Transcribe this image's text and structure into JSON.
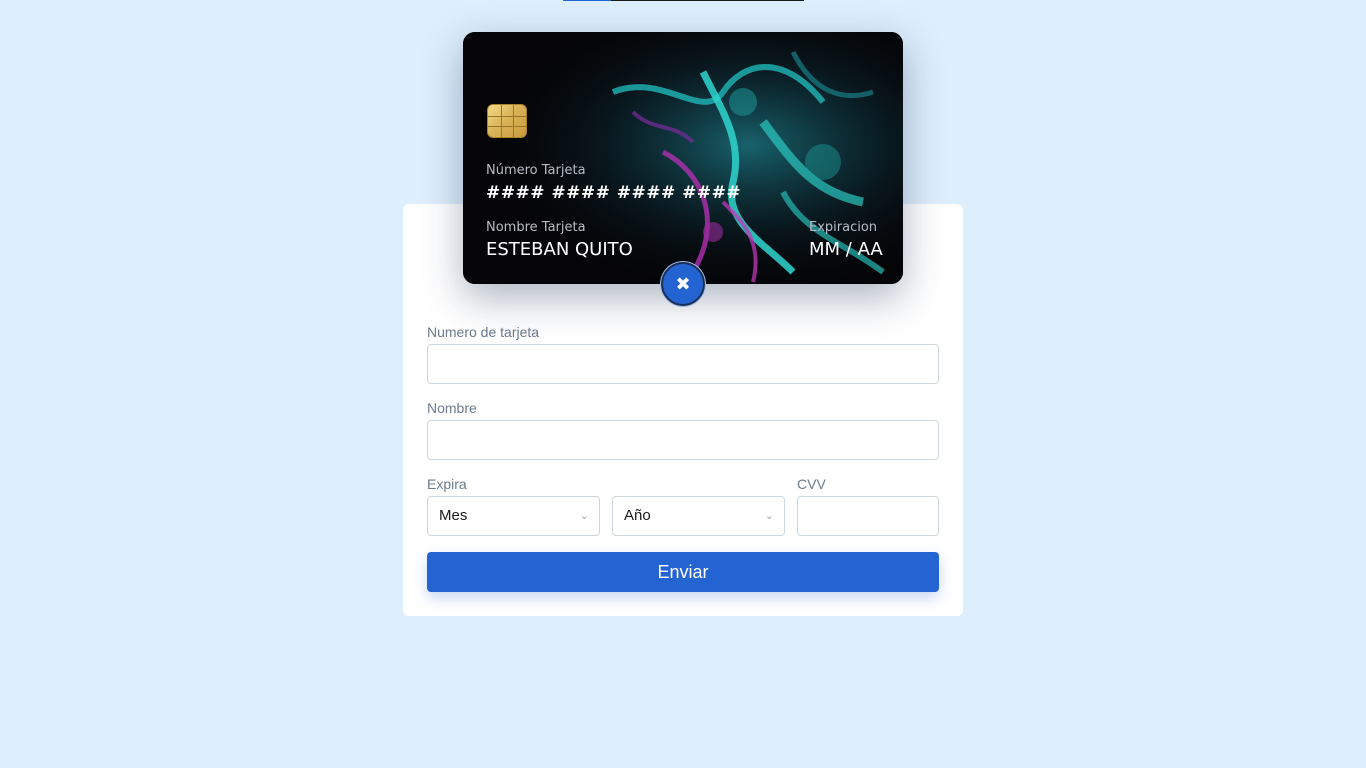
{
  "card": {
    "number_label": "Número Tarjeta",
    "number_value": "#### #### #### ####",
    "name_label": "Nombre Tarjeta",
    "name_value": "ESTEBAN QUITO",
    "expiry_label": "Expiracion",
    "expiry_value": "MM / AA"
  },
  "close_icon": "close-icon",
  "form": {
    "number_label": "Numero de tarjeta",
    "number_value": "",
    "name_label": "Nombre",
    "name_value": "",
    "expiry_label": "Expira",
    "month_value": "Mes",
    "year_value": "Año",
    "cvv_label": "CVV",
    "cvv_value": "",
    "submit_label": "Enviar"
  },
  "colors": {
    "background": "#ddeefc",
    "accent": "#2364d2",
    "card_bg": "#050508"
  }
}
